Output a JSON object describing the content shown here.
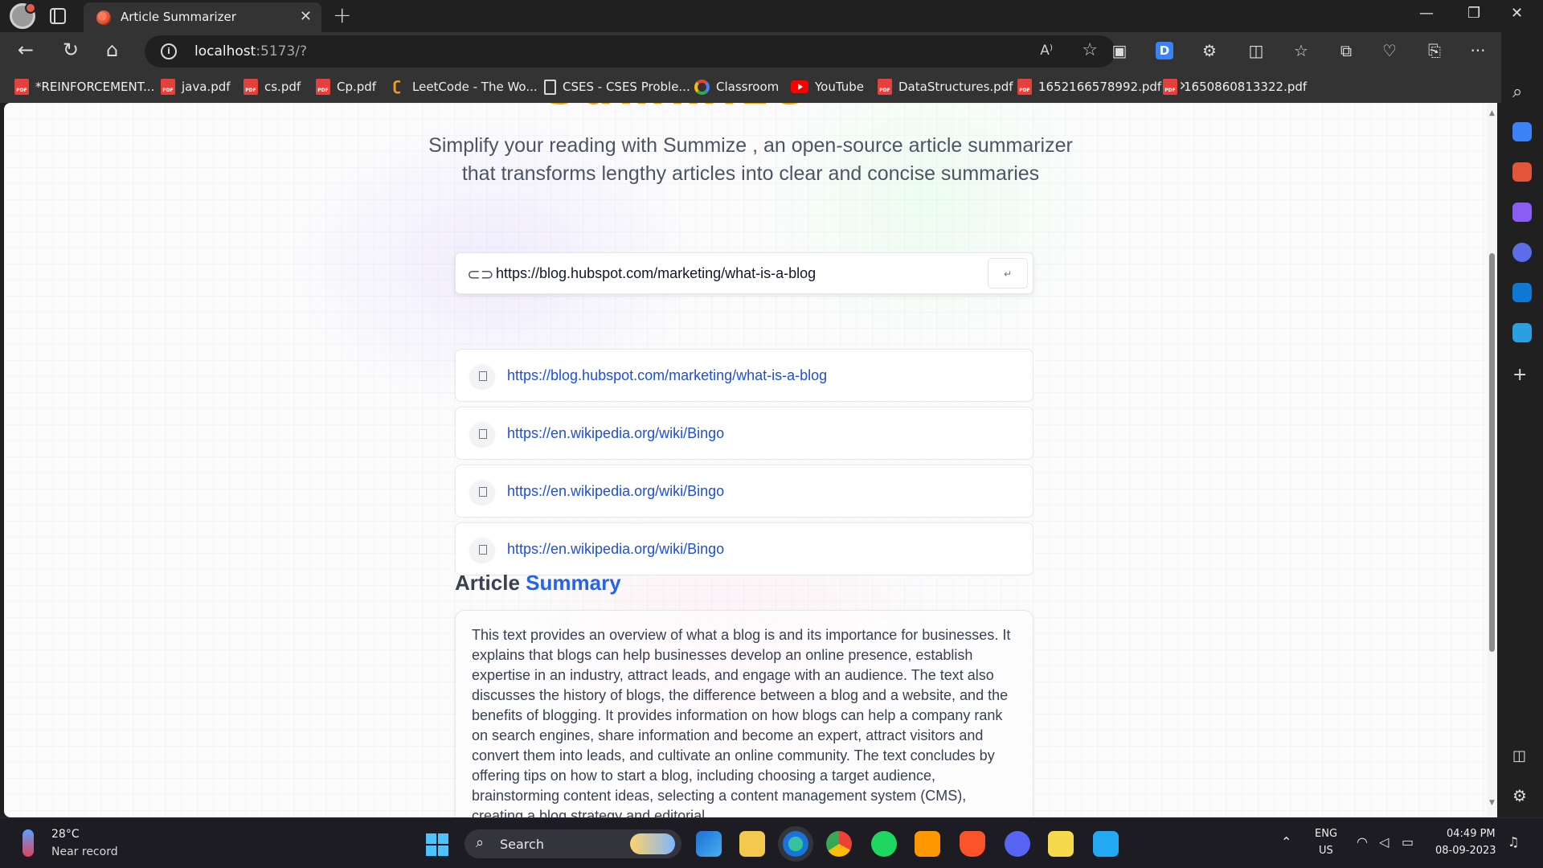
{
  "browser": {
    "tab_title": "Article Summarizer",
    "new_tab_symbol": "+",
    "close_tab_symbol": "✕",
    "url_host": "localhost",
    "url_rest": ":5173/?",
    "read_aloud_symbol": "A⁾",
    "favorite_symbol": "☆",
    "more_symbol": "···",
    "bookmarks": [
      {
        "label": "*REINFORCEMENT...",
        "icon": "pdf-icon"
      },
      {
        "label": "java.pdf",
        "icon": "pdf-icon"
      },
      {
        "label": "cs.pdf",
        "icon": "pdf-icon"
      },
      {
        "label": "Cp.pdf",
        "icon": "pdf-icon"
      },
      {
        "label": "LeetCode - The Wo...",
        "icon": "leetcode-icon"
      },
      {
        "label": "CSES - CSES Proble...",
        "icon": "document-icon"
      },
      {
        "label": "Classroom",
        "icon": "google-icon"
      },
      {
        "label": "YouTube",
        "icon": "youtube-icon"
      },
      {
        "label": "DataStructures.pdf",
        "icon": "pdf-icon"
      },
      {
        "label": "1652166578992.pdf",
        "icon": "pdf-icon"
      },
      {
        "label": "1650860813322.pdf",
        "icon": "pdf-icon"
      }
    ]
  },
  "page": {
    "tagline_line1": "Simplify your reading with Summize , an open-source article summarizer",
    "tagline_line2": "that transforms lengthy articles into clear and concise summaries",
    "search": {
      "value": "https://blog.hubspot.com/marketing/what-is-a-blog",
      "submit_symbol": "↵"
    },
    "history": [
      "https://blog.hubspot.com/marketing/what-is-a-blog",
      "https://en.wikipedia.org/wiki/Bingo",
      "https://en.wikipedia.org/wiki/Bingo",
      "https://en.wikipedia.org/wiki/Bingo"
    ],
    "summary_heading_plain": "Article",
    "summary_heading_accent": "Summary",
    "summary_text": "This text provides an overview of what a blog is and its importance for businesses. It explains that blogs can help businesses develop an online presence, establish expertise in an industry, attract leads, and engage with an audience. The text also discusses the history of blogs, the difference between a blog and a website, and the benefits of blogging. It provides information on how blogs can help a company rank on search engines, share information and become an expert, attract visitors and convert them into leads, and cultivate an online community. The text concludes by offering tips on how to start a blog, including choosing a target audience, brainstorming content ideas, selecting a content management system (CMS), creating a blog strategy and editorial"
  },
  "taskbar": {
    "weather_temp": "28°C",
    "weather_status": "Near record",
    "search_label": "Search",
    "lang": "ENG",
    "region": "US",
    "time": "04:49 PM",
    "date": "08-09-2023"
  },
  "colors": {
    "accent_blue": "#2563eb",
    "link_blue": "#1d4ed8",
    "heading_orange": "#f59e0b"
  }
}
